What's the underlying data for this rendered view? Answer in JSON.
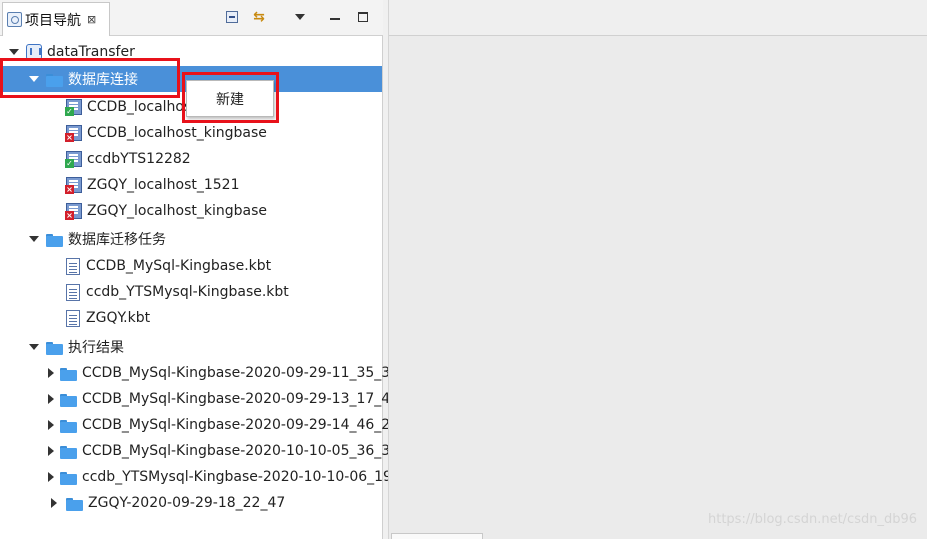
{
  "view": {
    "title": "项目导航",
    "close_glyph": "⊠"
  },
  "toolbar": {
    "collapse_icon": "collapse-all-icon",
    "link_icon": "link-editor-icon",
    "menu_icon": "view-menu-icon",
    "minimize_icon": "minimize-icon",
    "maximize_icon": "maximize-icon"
  },
  "tree": {
    "project": "dataTransfer",
    "db_connections": {
      "label": "数据库连接",
      "items": [
        {
          "label": "CCDB_localhost",
          "status": "ok"
        },
        {
          "label": "CCDB_localhost_kingbase",
          "status": "err"
        },
        {
          "label": "ccdbYTS12282",
          "status": "ok"
        },
        {
          "label": "ZGQY_localhost_1521",
          "status": "err"
        },
        {
          "label": "ZGQY_localhost_kingbase",
          "status": "err"
        }
      ]
    },
    "migration_tasks": {
      "label": "数据库迁移任务",
      "items": [
        "CCDB_MySql-Kingbase.kbt",
        "ccdb_YTSMysql-Kingbase.kbt",
        "ZGQY.kbt"
      ]
    },
    "results": {
      "label": "执行结果",
      "items": [
        "CCDB_MySql-Kingbase-2020-09-29-11_35_3",
        "CCDB_MySql-Kingbase-2020-09-29-13_17_4",
        "CCDB_MySql-Kingbase-2020-09-29-14_46_2",
        "CCDB_MySql-Kingbase-2020-10-10-05_36_3",
        "ccdb_YTSMysql-Kingbase-2020-10-10-06_19",
        "ZGQY-2020-09-29-18_22_47"
      ]
    }
  },
  "context_menu": {
    "new_label": "新建"
  },
  "watermark": "https://blog.csdn.net/csdn_db96",
  "colors": {
    "selection": "#4a90d9",
    "highlight": "#e8111a"
  }
}
